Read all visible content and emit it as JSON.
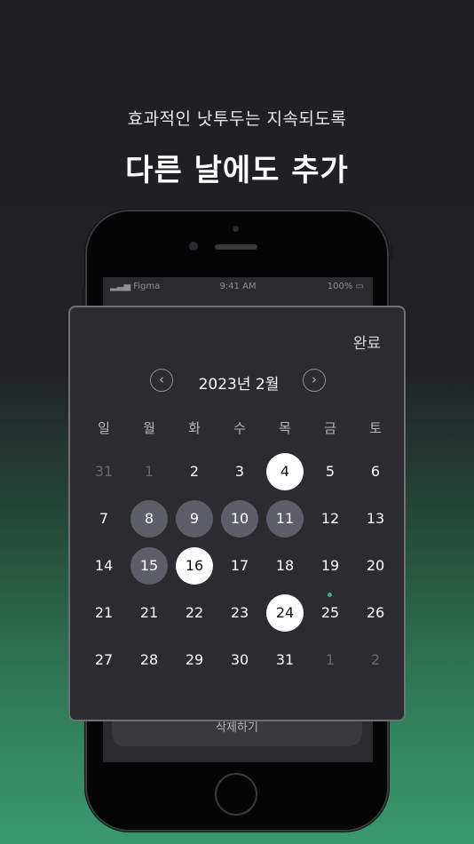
{
  "header": {
    "subtitle": "효과적인 낫투두는 지속되도록",
    "title": "다른 날에도 추가"
  },
  "status_bar": {
    "signal": "Figma",
    "time": "9:41 AM",
    "right": "100%"
  },
  "screen": {
    "delete_label": "삭제하기"
  },
  "calendar": {
    "done_label": "완료",
    "prev_icon": "‹",
    "next_icon": "›",
    "month_label": "2023년 2월",
    "weekdays": [
      "일",
      "월",
      "화",
      "수",
      "목",
      "금",
      "토"
    ],
    "weeks": [
      [
        {
          "d": "31",
          "m": true
        },
        {
          "d": "1",
          "m": true
        },
        {
          "d": "2"
        },
        {
          "d": "3"
        },
        {
          "d": "4",
          "s": "white"
        },
        {
          "d": "5"
        },
        {
          "d": "6"
        }
      ],
      [
        {
          "d": "7"
        },
        {
          "d": "8",
          "s": "dark"
        },
        {
          "d": "9",
          "s": "dark"
        },
        {
          "d": "10",
          "s": "dark"
        },
        {
          "d": "11",
          "s": "dark"
        },
        {
          "d": "12"
        },
        {
          "d": "13"
        }
      ],
      [
        {
          "d": "14"
        },
        {
          "d": "15",
          "s": "dark"
        },
        {
          "d": "16",
          "s": "white"
        },
        {
          "d": "17"
        },
        {
          "d": "18"
        },
        {
          "d": "19"
        },
        {
          "d": "20"
        }
      ],
      [
        {
          "d": "21"
        },
        {
          "d": "21"
        },
        {
          "d": "22"
        },
        {
          "d": "23"
        },
        {
          "d": "24",
          "s": "white"
        },
        {
          "d": "25",
          "dot": true
        },
        {
          "d": "26"
        }
      ],
      [
        {
          "d": "27"
        },
        {
          "d": "28"
        },
        {
          "d": "29"
        },
        {
          "d": "30"
        },
        {
          "d": "31"
        },
        {
          "d": "1",
          "m": true
        },
        {
          "d": "2",
          "m": true
        }
      ]
    ],
    "accent_color": "#3cb07c"
  }
}
